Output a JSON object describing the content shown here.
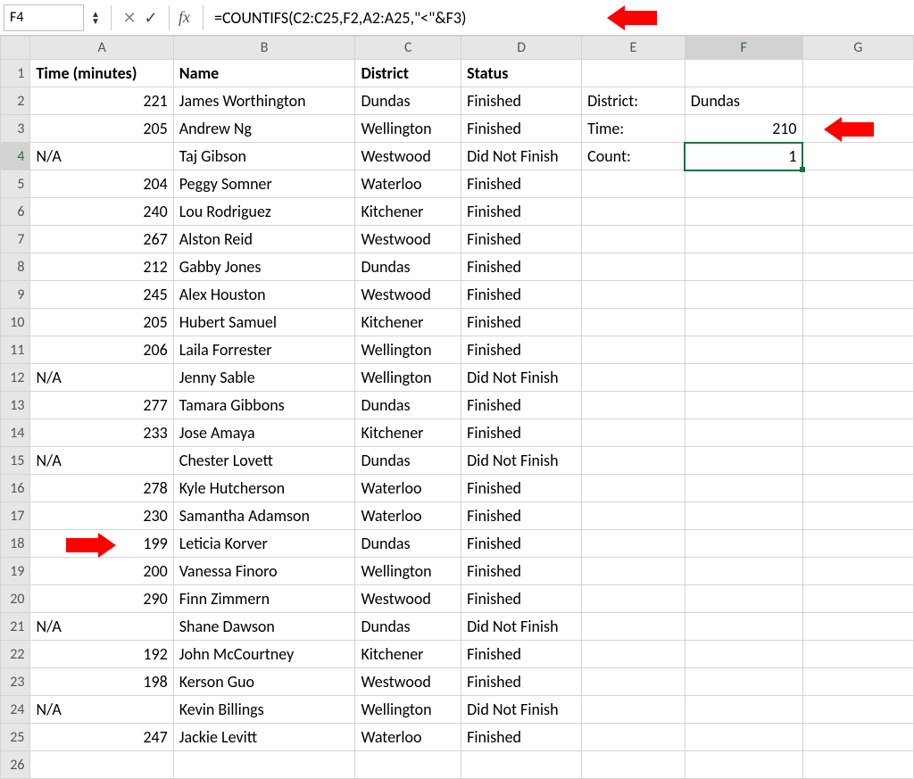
{
  "formula_bar": {
    "cell_ref": "F4",
    "formula": "=COUNTIFS(C2:C25,F2,A2:A25,\"<\"&F3)",
    "fx_label": "fx"
  },
  "columns": [
    "A",
    "B",
    "C",
    "D",
    "E",
    "F",
    "G"
  ],
  "row_numbers": [
    1,
    2,
    3,
    4,
    5,
    6,
    7,
    8,
    9,
    10,
    11,
    12,
    13,
    14,
    15,
    16,
    17,
    18,
    19,
    20,
    21,
    22,
    23,
    24,
    25,
    26
  ],
  "headers": {
    "A": "Time (minutes)",
    "B": "Name",
    "C": "District",
    "D": "Status"
  },
  "side": {
    "E2": "District:",
    "F2": "Dundas",
    "E3": "Time:",
    "F3": "210",
    "E4": "Count:",
    "F4": "1"
  },
  "rows": [
    {
      "time": "221",
      "name": "James Worthington",
      "district": "Dundas",
      "status": "Finished"
    },
    {
      "time": "205",
      "name": "Andrew Ng",
      "district": "Wellington",
      "status": "Finished"
    },
    {
      "time": "N/A",
      "name": "Taj Gibson",
      "district": "Westwood",
      "status": "Did Not Finish"
    },
    {
      "time": "204",
      "name": "Peggy Somner",
      "district": "Waterloo",
      "status": "Finished"
    },
    {
      "time": "240",
      "name": "Lou Rodriguez",
      "district": "Kitchener",
      "status": "Finished"
    },
    {
      "time": "267",
      "name": "Alston Reid",
      "district": "Westwood",
      "status": "Finished"
    },
    {
      "time": "212",
      "name": "Gabby Jones",
      "district": "Dundas",
      "status": "Finished"
    },
    {
      "time": "245",
      "name": "Alex Houston",
      "district": "Westwood",
      "status": "Finished"
    },
    {
      "time": "205",
      "name": "Hubert Samuel",
      "district": "Kitchener",
      "status": "Finished"
    },
    {
      "time": "206",
      "name": "Laila Forrester",
      "district": "Wellington",
      "status": "Finished"
    },
    {
      "time": "N/A",
      "name": "Jenny Sable",
      "district": "Wellington",
      "status": "Did Not Finish"
    },
    {
      "time": "277",
      "name": "Tamara Gibbons",
      "district": "Dundas",
      "status": "Finished"
    },
    {
      "time": "233",
      "name": "Jose Amaya",
      "district": "Kitchener",
      "status": "Finished"
    },
    {
      "time": "N/A",
      "name": "Chester Lovett",
      "district": "Dundas",
      "status": "Did Not Finish"
    },
    {
      "time": "278",
      "name": "Kyle Hutcherson",
      "district": "Waterloo",
      "status": "Finished"
    },
    {
      "time": "230",
      "name": "Samantha Adamson",
      "district": "Waterloo",
      "status": "Finished"
    },
    {
      "time": "199",
      "name": "Leticia Korver",
      "district": "Dundas",
      "status": "Finished"
    },
    {
      "time": "200",
      "name": "Vanessa Finoro",
      "district": "Wellington",
      "status": "Finished"
    },
    {
      "time": "290",
      "name": "Finn Zimmern",
      "district": "Westwood",
      "status": "Finished"
    },
    {
      "time": "N/A",
      "name": "Shane Dawson",
      "district": "Dundas",
      "status": "Did Not Finish"
    },
    {
      "time": "192",
      "name": "John McCourtney",
      "district": "Kitchener",
      "status": "Finished"
    },
    {
      "time": "198",
      "name": "Kerson Guo",
      "district": "Westwood",
      "status": "Finished"
    },
    {
      "time": "N/A",
      "name": "Kevin Billings",
      "district": "Wellington",
      "status": "Did Not Finish"
    },
    {
      "time": "247",
      "name": "Jackie Levitt",
      "district": "Waterloo",
      "status": "Finished"
    }
  ],
  "chart_data": {
    "type": "table",
    "title": "Race results with COUNTIFS lookup",
    "columns": [
      "Time (minutes)",
      "Name",
      "District",
      "Status"
    ],
    "records": [
      [
        221,
        "James Worthington",
        "Dundas",
        "Finished"
      ],
      [
        205,
        "Andrew Ng",
        "Wellington",
        "Finished"
      ],
      [
        null,
        "Taj Gibson",
        "Westwood",
        "Did Not Finish"
      ],
      [
        204,
        "Peggy Somner",
        "Waterloo",
        "Finished"
      ],
      [
        240,
        "Lou Rodriguez",
        "Kitchener",
        "Finished"
      ],
      [
        267,
        "Alston Reid",
        "Westwood",
        "Finished"
      ],
      [
        212,
        "Gabby Jones",
        "Dundas",
        "Finished"
      ],
      [
        245,
        "Alex Houston",
        "Westwood",
        "Finished"
      ],
      [
        205,
        "Hubert Samuel",
        "Kitchener",
        "Finished"
      ],
      [
        206,
        "Laila Forrester",
        "Wellington",
        "Finished"
      ],
      [
        null,
        "Jenny Sable",
        "Wellington",
        "Did Not Finish"
      ],
      [
        277,
        "Tamara Gibbons",
        "Dundas",
        "Finished"
      ],
      [
        233,
        "Jose Amaya",
        "Kitchener",
        "Finished"
      ],
      [
        null,
        "Chester Lovett",
        "Dundas",
        "Did Not Finish"
      ],
      [
        278,
        "Kyle Hutcherson",
        "Waterloo",
        "Finished"
      ],
      [
        230,
        "Samantha Adamson",
        "Waterloo",
        "Finished"
      ],
      [
        199,
        "Leticia Korver",
        "Dundas",
        "Finished"
      ],
      [
        200,
        "Vanessa Finoro",
        "Wellington",
        "Finished"
      ],
      [
        290,
        "Finn Zimmern",
        "Westwood",
        "Finished"
      ],
      [
        null,
        "Shane Dawson",
        "Dundas",
        "Did Not Finish"
      ],
      [
        192,
        "John McCourtney",
        "Kitchener",
        "Finished"
      ],
      [
        198,
        "Kerson Guo",
        "Westwood",
        "Finished"
      ],
      [
        null,
        "Kevin Billings",
        "Wellington",
        "Did Not Finish"
      ],
      [
        247,
        "Jackie Levitt",
        "Waterloo",
        "Finished"
      ]
    ],
    "lookup": {
      "district": "Dundas",
      "time_threshold": 210,
      "count_result": 1
    },
    "formula": "=COUNTIFS(C2:C25,F2,A2:A25,\"<\"&F3)"
  }
}
